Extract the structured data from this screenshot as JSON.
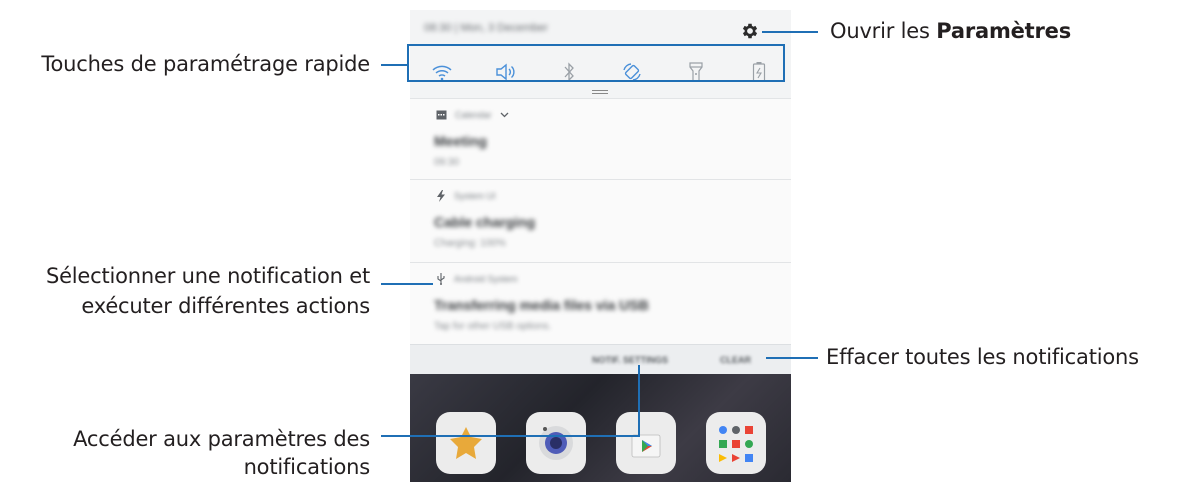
{
  "callouts": {
    "settings_prefix": "Ouvrir les ",
    "settings_bold": "Paramètres",
    "quick_settings": "Touches de paramétrage rapide",
    "select_notification_line1": "Sélectionner une notification et",
    "select_notification_line2": "exécuter différentes actions",
    "clear_all": "Effacer toutes les notifications",
    "notif_settings_line1": "Accéder aux paramètres des",
    "notif_settings_line2": "notifications"
  },
  "phone": {
    "status_text": "08:30 | Mon, 3 December",
    "quick_icons": [
      "wifi-icon",
      "sound-icon",
      "bluetooth-icon",
      "auto-rotate-icon",
      "flashlight-icon",
      "power-saving-icon"
    ],
    "accent_color": "#4a90d9",
    "notifications": [
      {
        "app": "Calendar",
        "icon": "calendar-icon",
        "title": "Meeting",
        "subtitle": "09:30"
      },
      {
        "app": "System UI",
        "icon": "lightning-icon",
        "title": "Cable charging",
        "subtitle": "Charging: 100%"
      },
      {
        "app": "Android System",
        "icon": "usb-icon",
        "title": "Transferring media files via USB",
        "subtitle": "Tap for other USB options."
      }
    ],
    "footer": {
      "settings_label": "NOTIF. SETTINGS",
      "clear_label": "CLEAR"
    },
    "home_icons": [
      "bixby-icon",
      "camera-icon",
      "play-store-icon",
      "google-folder-icon"
    ]
  },
  "callout_line_color": "#1f6fb5"
}
